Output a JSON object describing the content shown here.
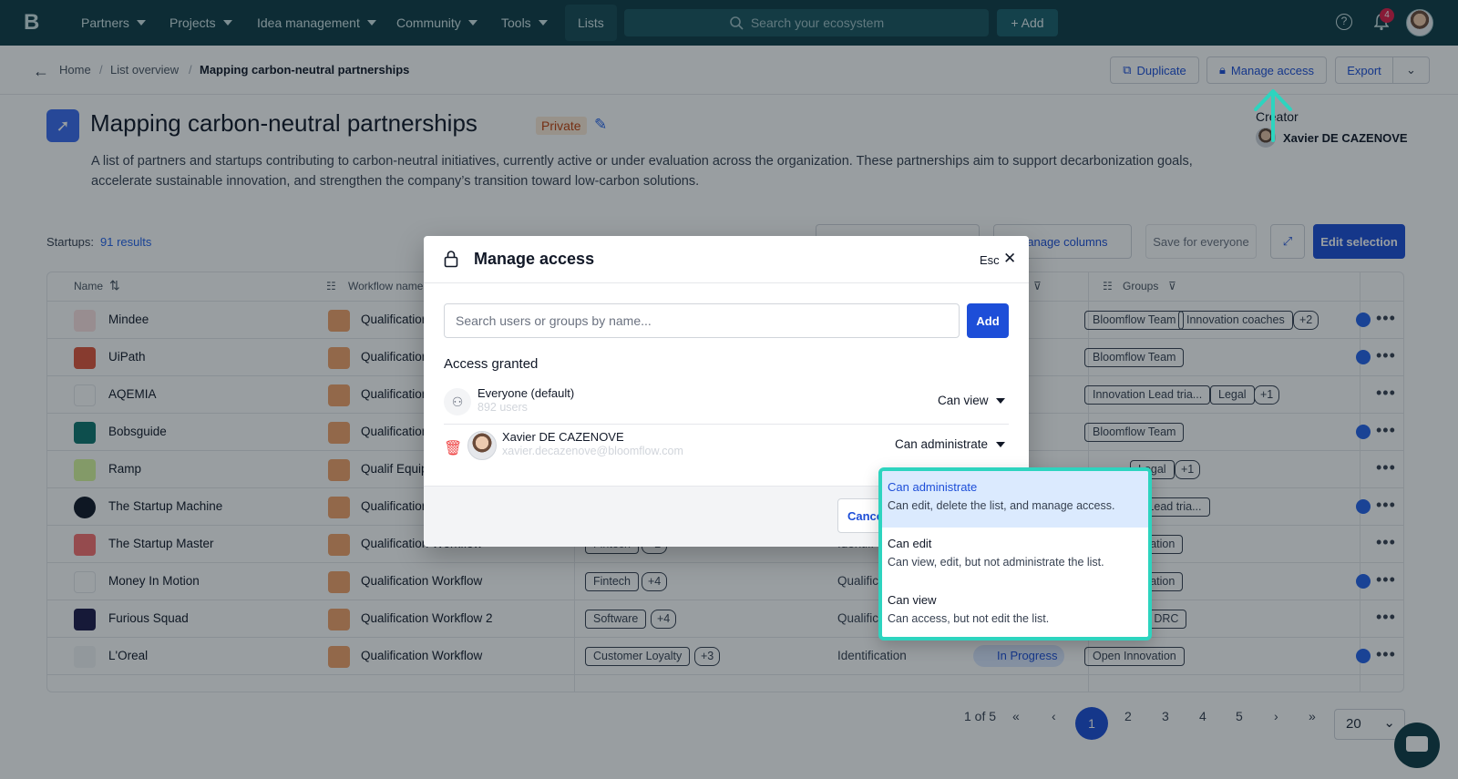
{
  "nav": {
    "items": [
      "Partners",
      "Projects",
      "Idea management",
      "Community",
      "Tools",
      "Lists"
    ],
    "search_placeholder": "Search your ecosystem",
    "add_label": "+ Add",
    "notification_count": "4"
  },
  "breadcrumb": {
    "home": "Home",
    "overview": "List overview",
    "current": "Mapping carbon-neutral partnerships"
  },
  "actions": {
    "duplicate": "Duplicate",
    "manage_access": "Manage access",
    "export": "Export"
  },
  "list": {
    "title": "Mapping carbon-neutral partnerships",
    "visibility": "Private",
    "description": "A list of partners and startups contributing to carbon-neutral initiatives, currently active or under evaluation across the organization. These partnerships aim to support decarbonization goals, accelerate sustainable innovation, and strengthen the company’s transition toward low-carbon solutions.",
    "creator_label": "Creator",
    "creator_name": "Xavier DE CAZENOVE"
  },
  "toolbar": {
    "results_label": "Startups:",
    "results_count": "91 results",
    "manage_columns": "Manage columns",
    "save_for_everyone": "Save for everyone",
    "edit_selection": "Edit selection"
  },
  "table": {
    "headers": {
      "name": "Name",
      "workflow": "Workflow name",
      "groups": "Groups"
    },
    "rows": [
      {
        "name": "Mindee",
        "workflow": "Qualification",
        "groups": [
          "Bloomflow Team",
          "Innovation coaches",
          "+2"
        ],
        "logo": "#e11d48"
      },
      {
        "name": "UiPath",
        "workflow": "Qualification",
        "groups": [
          "Bloomflow Team"
        ],
        "logo": "#e0553b"
      },
      {
        "name": "AQEMIA",
        "workflow": "Qualification",
        "groups": [
          "Innovation Lead tria...",
          "Legal",
          "+1"
        ],
        "logo": "#ffffff"
      },
      {
        "name": "Bobsguide",
        "workflow": "Qualification",
        "groups": [
          "Bloomflow Team"
        ],
        "logo": "#0f766e"
      },
      {
        "name": "Ramp",
        "workflow": "Qualif Equip",
        "groups": [
          "",
          "Legal",
          "+1"
        ],
        "logo": "#d9f99d"
      },
      {
        "name": "The Startup Machine",
        "workflow": "Qualification",
        "groups": [
          "n Lead tria..."
        ],
        "logo": "#111827"
      },
      {
        "name": "The Startup Master",
        "workflow": "Qualification Workflow",
        "tags": [
          "Fintech",
          "+2"
        ],
        "stage": "Identifi",
        "groups": [
          "ovation"
        ],
        "logo": "#f87171"
      },
      {
        "name": "Money In Motion",
        "workflow": "Qualification Workflow",
        "tags": [
          "Fintech",
          "+4"
        ],
        "stage": "Qualific",
        "groups": [
          "ovation"
        ],
        "logo": "#ffffff"
      },
      {
        "name": "Furious Squad",
        "workflow": "Qualification Workflow 2",
        "tags": [
          "Software",
          "+4"
        ],
        "stage": "Qualific",
        "groups": [
          "ab DRC"
        ],
        "logo": "#1e1b4b"
      },
      {
        "name": "L'Oreal",
        "workflow": "Qualification Workflow",
        "tags": [
          "Customer Loyalty",
          "+3"
        ],
        "stage": "Identification",
        "status": "In Progress",
        "groups": [
          "Open Innovation"
        ],
        "logo": "#f3f4f6"
      }
    ],
    "status_partial": "ress"
  },
  "pagination": {
    "summary": "1 of 5",
    "first": "«",
    "prev": "‹",
    "pages": [
      "1",
      "2",
      "3",
      "4",
      "5"
    ],
    "next": "›",
    "last": "»",
    "page_size": "20"
  },
  "modal": {
    "title": "Manage access",
    "esc": "Esc",
    "search_placeholder": "Search users or groups by name...",
    "add": "Add",
    "access_granted": "Access granted",
    "entries": [
      {
        "name": "Everyone (default)",
        "sub": "892 users",
        "permission": "Can view"
      },
      {
        "name": "Xavier DE CAZENOVE",
        "sub": "xavier.decazenove@bloomflow.com",
        "permission": "Can administrate"
      }
    ],
    "cancel": "Cancel"
  },
  "permission_menu": {
    "options": [
      {
        "title": "Can administrate",
        "desc": "Can edit, delete the list, and manage access."
      },
      {
        "title": "Can edit",
        "desc": "Can view, edit, but not administrate the list."
      },
      {
        "title": "Can view",
        "desc": "Can access, but not edit the list."
      }
    ]
  },
  "colors": {
    "nav_bg": "#0f3b45",
    "primary": "#1d4ed8",
    "highlight": "#2dd4bf",
    "private": "#c2410c"
  }
}
